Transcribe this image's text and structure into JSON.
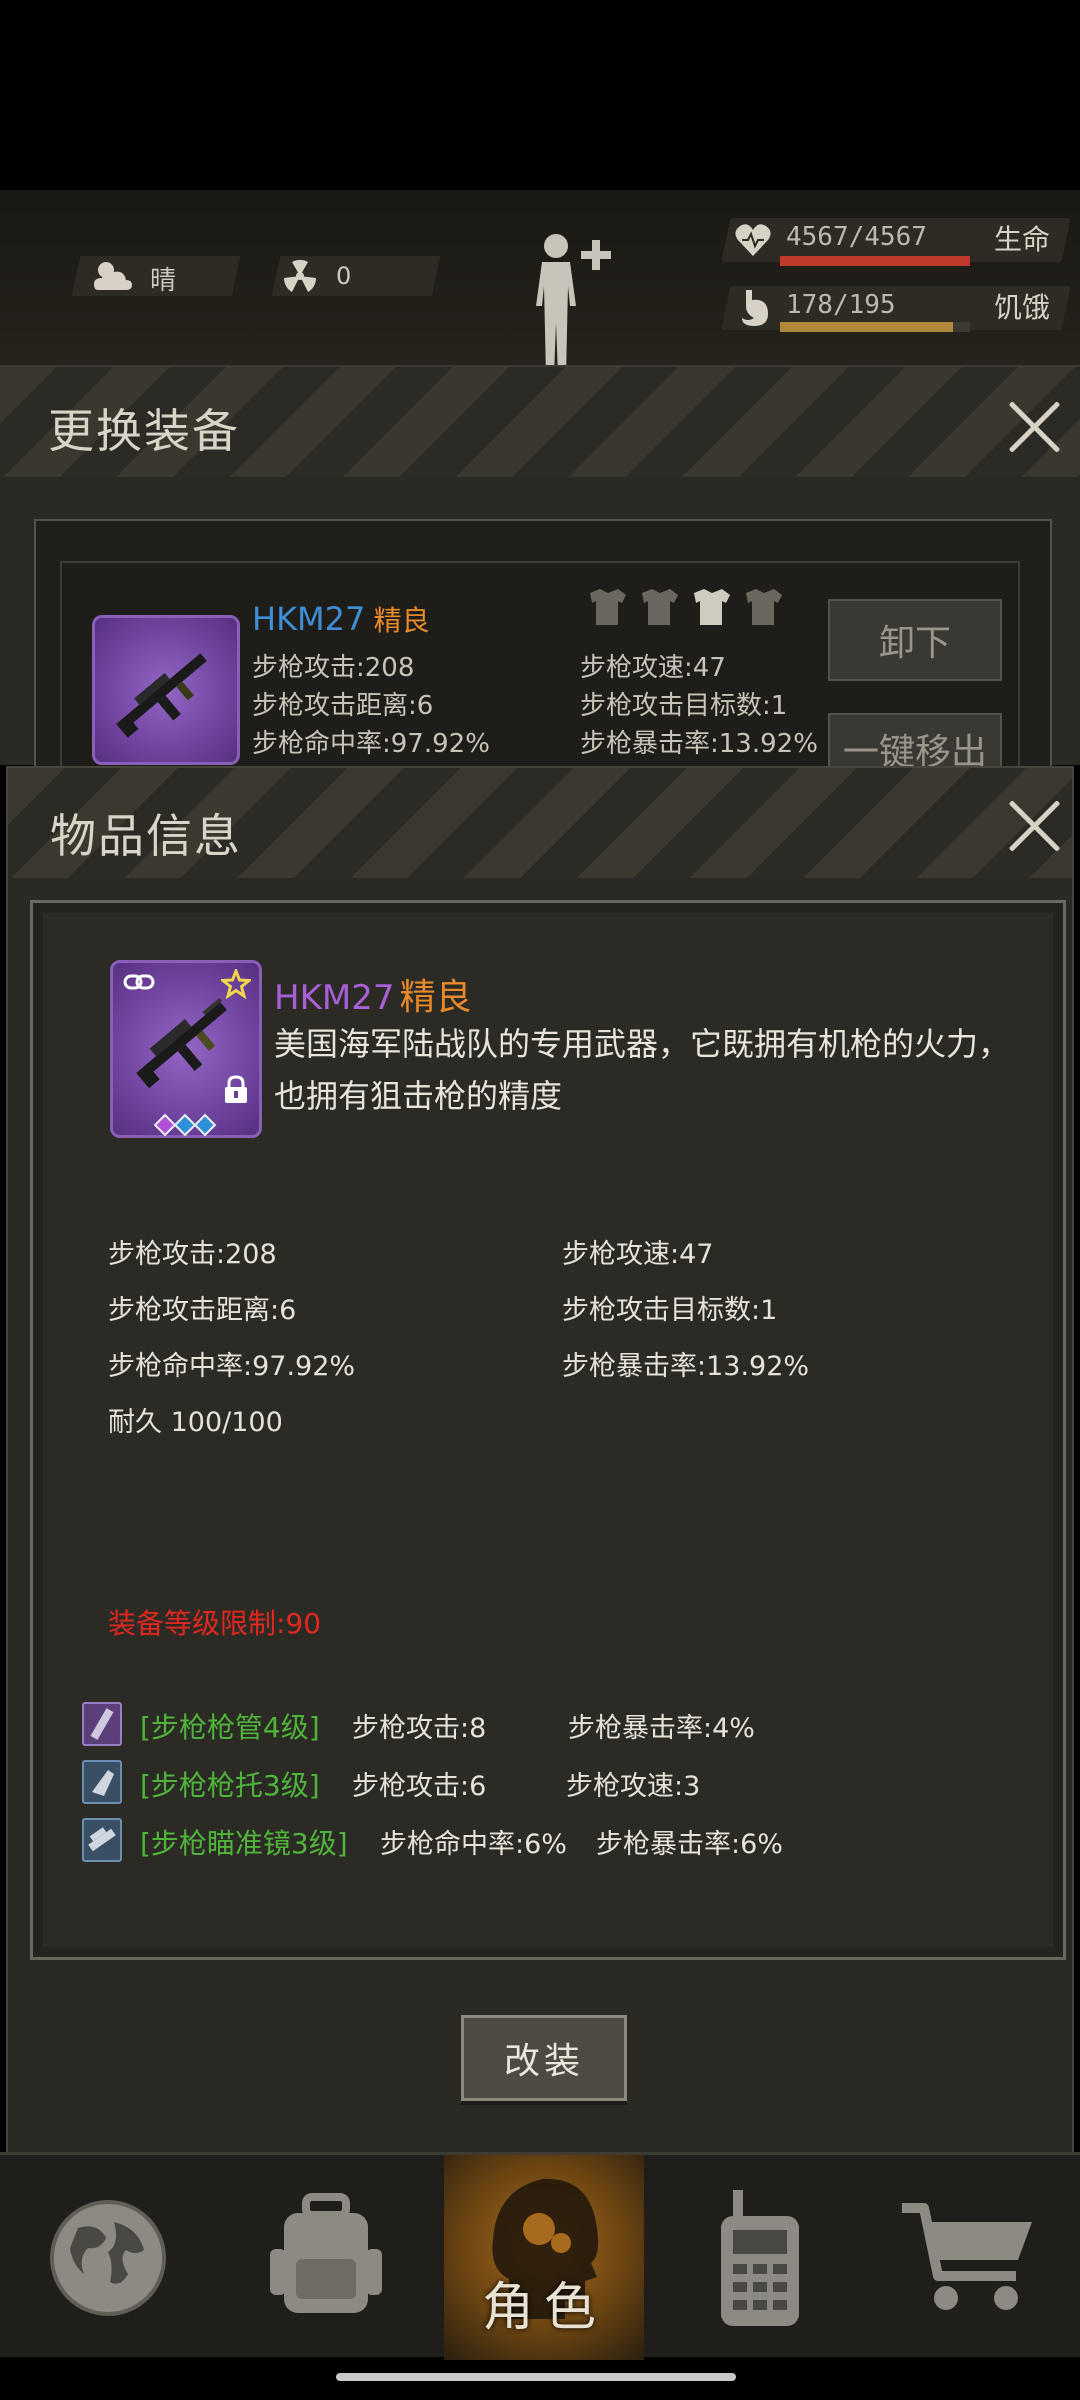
{
  "status": {
    "weather_label": "晴",
    "radiation_value": "0",
    "health": {
      "value": "4567/4567",
      "label": "生命",
      "fraction": 1.0,
      "color": "#c0392b"
    },
    "hunger": {
      "value": "178/195",
      "label": "饥饿",
      "fraction": 0.91,
      "color": "#b08a3a"
    }
  },
  "equip_panel": {
    "title": "更换装备",
    "item_name": "HKM27",
    "item_quality": "精良",
    "stats": [
      "步枪攻击:208",
      "步枪攻速:47",
      "步枪攻击距离:6",
      "步枪攻击目标数:1",
      "步枪命中率:97.92%",
      "步枪暴击率:13.92%"
    ],
    "unequip_label": "卸下",
    "move_out_label": "一键移出"
  },
  "info_panel": {
    "title": "物品信息",
    "item_name": "HKM27",
    "item_quality": "精良",
    "description": "美国海军陆战队的专用武器，它既拥有机枪的火力，也拥有狙击枪的精度",
    "stats": {
      "attack": "步枪攻击:208",
      "speed": "步枪攻速:47",
      "range": "步枪攻击距离:6",
      "targets": "步枪攻击目标数:1",
      "accuracy": "步枪命中率:97.92%",
      "crit": "步枪暴击率:13.92%",
      "durability": "耐久 100/100"
    },
    "level_requirement": "装备等级限制:90",
    "mods": [
      {
        "name": "[步枪枪管4级]",
        "attr1": "步枪攻击:8",
        "attr2": "步枪暴击率:4%",
        "icon": "barrel-icon"
      },
      {
        "name": "[步枪枪托3级]",
        "attr1": "步枪攻击:6",
        "attr2": "步枪攻速:3",
        "icon": "stock-icon"
      },
      {
        "name": "[步枪瞄准镜3级]",
        "attr1": "步枪命中率:6%",
        "attr2": "步枪暴击率:6%",
        "icon": "scope-icon"
      }
    ],
    "modify_button": "改装"
  },
  "nav": {
    "items": [
      {
        "icon": "globe-icon"
      },
      {
        "icon": "backpack-icon"
      },
      {
        "icon": "character-icon",
        "label": "角色",
        "active": true
      },
      {
        "icon": "radio-icon"
      },
      {
        "icon": "cart-icon"
      }
    ]
  },
  "colors": {
    "quality_orange": "#e88a2a",
    "item_purple": "#8a5fb8",
    "mod_green": "#4fb53a",
    "requirement_red": "#e0281e"
  }
}
